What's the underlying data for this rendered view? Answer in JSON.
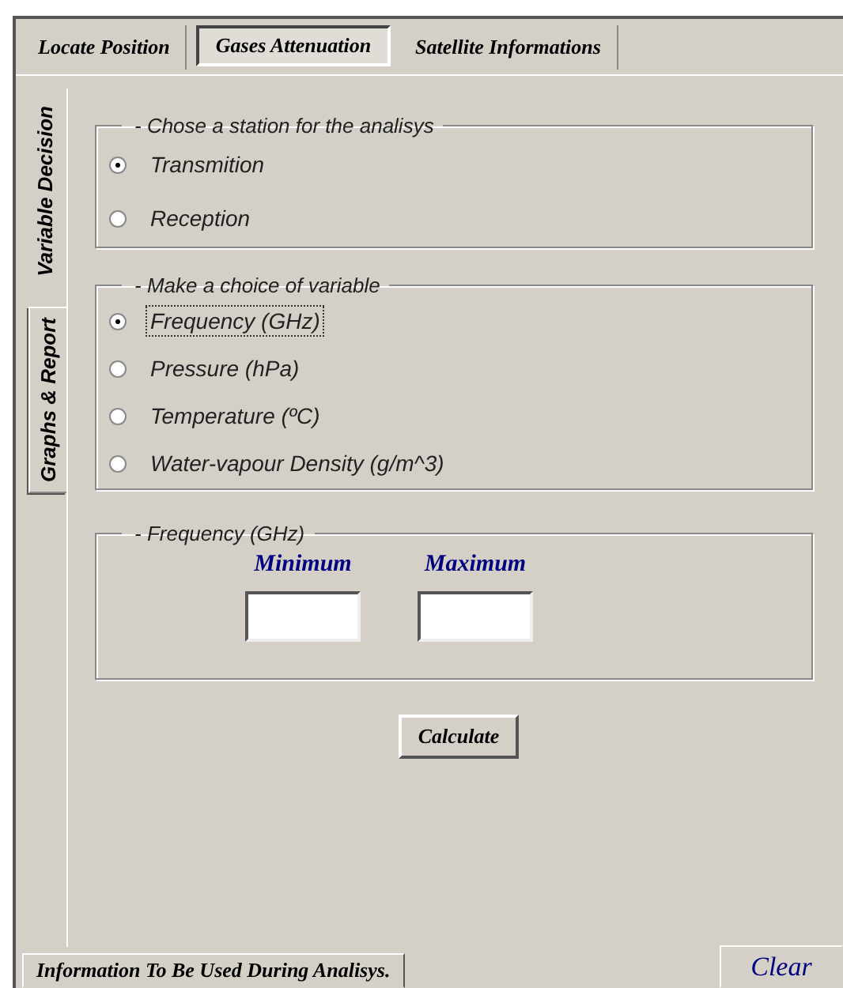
{
  "tabs": [
    {
      "label": "Locate Position",
      "selected": false
    },
    {
      "label": "Gases Attenuation",
      "selected": true
    },
    {
      "label": "Satellite Informations",
      "selected": false
    }
  ],
  "side_tabs": [
    {
      "label": "Variable Decision",
      "selected": true
    },
    {
      "label": "Graphs & Report",
      "selected": false
    }
  ],
  "station_group": {
    "title": "- Chose a station for the analisys",
    "options": [
      {
        "label": "Transmition",
        "selected": true,
        "focused": false
      },
      {
        "label": "Reception",
        "selected": false,
        "focused": false
      }
    ]
  },
  "variable_group": {
    "title": "- Make a choice of variable",
    "options": [
      {
        "label": "Frequency  (GHz)",
        "selected": true,
        "focused": true
      },
      {
        "label": "Pressure  (hPa)",
        "selected": false,
        "focused": false
      },
      {
        "label": "Temperature  (ºC)",
        "selected": false,
        "focused": false
      },
      {
        "label": "Water-vapour Density (g/m^3)",
        "selected": false,
        "focused": false
      }
    ]
  },
  "range_group": {
    "title": "- Frequency  (GHz)",
    "fields": [
      {
        "label": "Minimum"
      },
      {
        "label": "Maximum"
      }
    ]
  },
  "calculate_button": "Calculate",
  "bottom_tab": "Information To Be Used During Analisys.",
  "clear_button": "Clear"
}
